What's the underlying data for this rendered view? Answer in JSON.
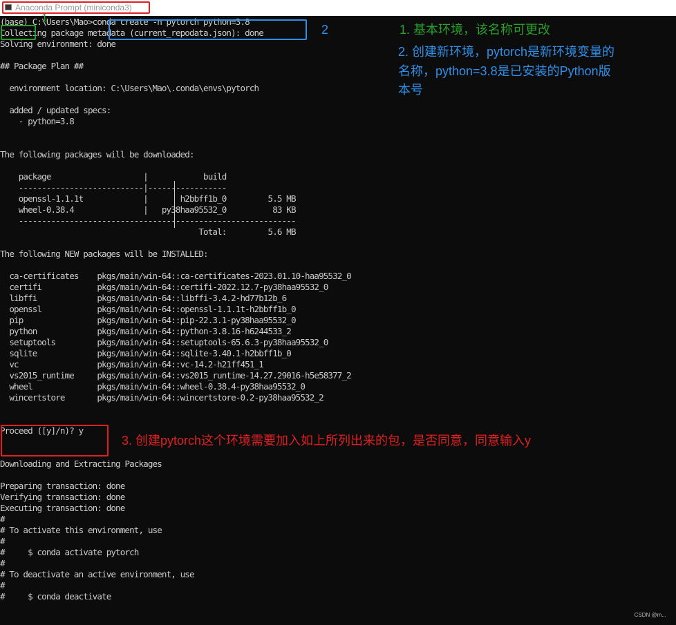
{
  "window": {
    "title": "Anaconda Prompt (miniconda3)"
  },
  "terminal": {
    "lines": [
      "(base) C:\\Users\\Mao>conda create -n pytorch python=3.8",
      "Collecting package metadata (current_repodata.json): done",
      "Solving environment: done",
      "",
      "## Package Plan ##",
      "",
      "  environment location: C:\\Users\\Mao\\.conda\\envs\\pytorch",
      "",
      "  added / updated specs:",
      "    - python=3.8",
      "",
      "",
      "The following packages will be downloaded:",
      "",
      "    package                    |            build",
      "    ---------------------------|-----------------",
      "    openssl-1.1.1t             |       h2bbff1b_0         5.5 MB",
      "    wheel-0.38.4               |   py38haa95532_0          83 KB",
      "    ------------------------------------------------------------",
      "                                           Total:         5.6 MB",
      "",
      "The following NEW packages will be INSTALLED:",
      "",
      "  ca-certificates    pkgs/main/win-64::ca-certificates-2023.01.10-haa95532_0",
      "  certifi            pkgs/main/win-64::certifi-2022.12.7-py38haa95532_0",
      "  libffi             pkgs/main/win-64::libffi-3.4.2-hd77b12b_6",
      "  openssl            pkgs/main/win-64::openssl-1.1.1t-h2bbff1b_0",
      "  pip                pkgs/main/win-64::pip-22.3.1-py38haa95532_0",
      "  python             pkgs/main/win-64::python-3.8.16-h6244533_2",
      "  setuptools         pkgs/main/win-64::setuptools-65.6.3-py38haa95532_0",
      "  sqlite             pkgs/main/win-64::sqlite-3.40.1-h2bbff1b_0",
      "  vc                 pkgs/main/win-64::vc-14.2-h21ff451_1",
      "  vs2015_runtime     pkgs/main/win-64::vs2015_runtime-14.27.29016-h5e58377_2",
      "  wheel              pkgs/main/win-64::wheel-0.38.4-py38haa95532_0",
      "  wincertstore       pkgs/main/win-64::wincertstore-0.2-py38haa95532_2",
      "",
      "",
      "Proceed ([y]/n)? y",
      "",
      "",
      "Downloading and Extracting Packages",
      "",
      "Preparing transaction: done",
      "Verifying transaction: done",
      "Executing transaction: done",
      "#",
      "# To activate this environment, use",
      "#",
      "#     $ conda activate pytorch",
      "#",
      "# To deactivate an active environment, use",
      "#",
      "#     $ conda deactivate"
    ]
  },
  "annotations": {
    "label_1": "1",
    "label_2": "2",
    "note_1": "1. 基本环境，该名称可更改",
    "note_2_line1": "2. 创建新环境，pytorch是新环境变量的",
    "note_2_line2": "名称，python=3.8是已安装的Python版",
    "note_2_line3": "本号",
    "note_3": "3. 创建pytorch这个环境需要加入如上所列出来的包，是否同意，同意输入y"
  },
  "watermark": "CSDN @m...",
  "colors": {
    "background": "#0c0c0c",
    "text": "#cccccc",
    "green": "#2aa02a",
    "blue": "#2f8fe8",
    "red": "#e02020"
  }
}
